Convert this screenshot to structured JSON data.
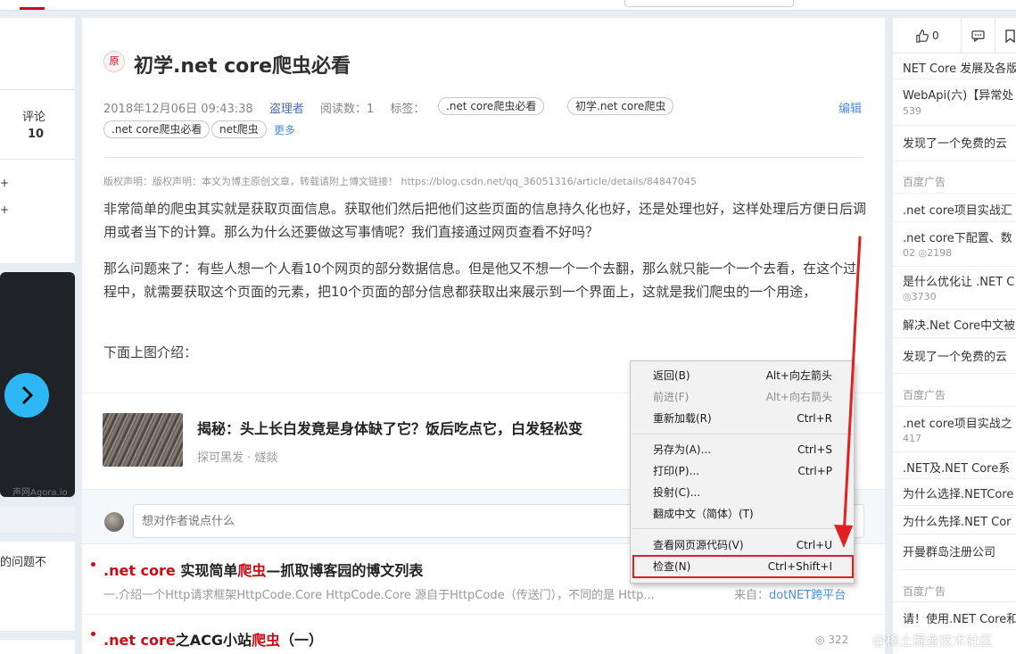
{
  "left": {
    "comment_label": "评论",
    "comment_count": "10",
    "plus_marks": [
      "+",
      "+"
    ],
    "ad_caption": "声网Agora.io",
    "bottom_text": "的问题不"
  },
  "article": {
    "original_badge": "原",
    "title": "初学.net core爬虫必看",
    "date": "2018年12月06日 09:43:38",
    "author": "盗理者",
    "read_count": "阅读数：1",
    "tags_label": "标签：",
    "tags": [
      ".net core爬虫必看",
      "初学.net core爬虫",
      ".net core爬虫必看",
      "net爬虫"
    ],
    "more": "更多",
    "edit": "编辑",
    "copyright": "版权声明：版权声明：本文为博主原创文章，转载请附上博文链接！ https://blog.csdn.net/qq_36051316/article/details/84847045",
    "p1": "非常简单的爬虫其实就是获取页面信息。获取他们然后把他们这些页面的信息持久化也好，还是处理也好，这样处理后方便日后调用或者当下的计算。那么为什么还要做这写事情呢？我们直接通过网页查看不好吗？",
    "p2": "那么问题来了：有些人想一个人看10个网页的部分数据信息。但是他又不想一个一个去翻，那么就只能一个一个去看，在这个过程中，就需要获取这个页面的元素，把10个页面的部分信息都获取出来展示到一个界面上，这就是我们爬虫的一个用途，",
    "p3": "下面上图介绍："
  },
  "ad": {
    "title": "揭秘：头上长白发竟是身体缺了它？饭后吃点它，白发轻松变",
    "source": "探可黑发 · 燧燚"
  },
  "comment": {
    "placeholder": "想对作者说点什么"
  },
  "recommend": [
    {
      "title_pre": ".net core",
      "title_mid": " 实现简单",
      "title_hl": "爬虫",
      "title_post": "—抓取博客园的博文列表",
      "desc": "一.介绍一个Http请求框架HttpCode.Core  HttpCode.Core 源自于HttpCode（传送门），不同的是 Http...",
      "from_label": "来自：",
      "from_link": "dotNET跨平台"
    },
    {
      "title_pre": ".net core",
      "title_mid": "之ACG小站",
      "title_hl": "爬虫",
      "title_post": "（一）",
      "views": "322"
    }
  ],
  "right": {
    "like_count": "0",
    "items": [
      {
        "text": "NET Core 发展及各版",
        "sub": ""
      },
      {
        "text": "WebApi(六)【异常处",
        "sub": "539"
      },
      {
        "text": "发现了一个免费的云",
        "sub": ""
      },
      {
        "text": ".net core项目实战汇",
        "sub": ""
      },
      {
        "text": ".net core下配置、数",
        "sub": "02  ◎2198"
      },
      {
        "text": "是什么优化让 .NET C",
        "sub": "◎3730"
      },
      {
        "text": "解决.Net Core中文被",
        "sub": ""
      },
      {
        "text": "发现了一个免费的云",
        "sub": ""
      },
      {
        "text": ".net core项目实战之",
        "sub": "417"
      },
      {
        "text": ".NET及.NET Core系",
        "sub": ""
      },
      {
        "text": "为什么选择.NETCore",
        "sub": ""
      },
      {
        "text": "为什么先择.NET Cor",
        "sub": ""
      },
      {
        "text": "开曼群岛注册公司",
        "sub": ""
      },
      {
        "text": "请！使用.NET Core和",
        "sub": ""
      }
    ],
    "ad_label": "百度广告"
  },
  "context_menu": {
    "items": [
      {
        "label": "返回(B)",
        "shortcut": "Alt+向左箭头",
        "enabled": true
      },
      {
        "label": "前进(F)",
        "shortcut": "Alt+向右箭头",
        "enabled": false
      },
      {
        "label": "重新加载(R)",
        "shortcut": "Ctrl+R",
        "enabled": true
      },
      {
        "label": "另存为(A)...",
        "shortcut": "Ctrl+S",
        "enabled": true
      },
      {
        "label": "打印(P)...",
        "shortcut": "Ctrl+P",
        "enabled": true
      },
      {
        "label": "投射(C)...",
        "shortcut": "",
        "enabled": true
      },
      {
        "label": "翻成中文（简体）(T)",
        "shortcut": "",
        "enabled": true
      },
      {
        "label": "查看网页源代码(V)",
        "shortcut": "Ctrl+U",
        "enabled": true
      },
      {
        "label": "检查(N)",
        "shortcut": "Ctrl+Shift+I",
        "enabled": true
      }
    ],
    "highlighted": "检查(N)"
  },
  "annotation_color": "#e12020",
  "accent_red": "#ca0c16",
  "link_blue": "#4d8fd1",
  "watermark": "@稀土掘金技术社区"
}
